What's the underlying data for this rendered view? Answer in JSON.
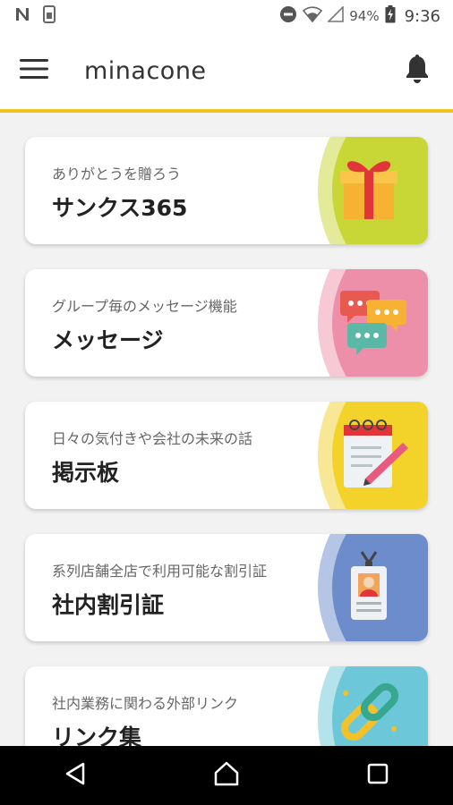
{
  "status_bar": {
    "battery_percent": "94%",
    "time": "9:36",
    "icons": [
      "n-icon",
      "sim-icon",
      "dnd-icon",
      "wifi-icon",
      "signal-icon",
      "battery-charging-icon"
    ]
  },
  "app_bar": {
    "title": "minacone",
    "menu_icon": "hamburger-menu-icon",
    "bell_icon": "bell-icon"
  },
  "cards": [
    {
      "subtitle": "ありがとうを贈ろう",
      "title": "サンクス365",
      "icon": "gift-icon",
      "color": "#c8d636",
      "ring_color": "#e3ea9a"
    },
    {
      "subtitle": "グループ毎のメッセージ機能",
      "title": "メッセージ",
      "icon": "chat-bubbles-icon",
      "color": "#ee8fa9",
      "ring_color": "#f7c9d5"
    },
    {
      "subtitle": "日々の気付きや会社の未来の話",
      "title": "掲示板",
      "icon": "notepad-pencil-icon",
      "color": "#f3d32a",
      "ring_color": "#f8e895"
    },
    {
      "subtitle": "系列店舗全店で利用可能な割引証",
      "title": "社内割引証",
      "icon": "id-badge-icon",
      "color": "#6c8ccc",
      "ring_color": "#b5c5e5"
    },
    {
      "subtitle": "社内業務に関わる外部リンク",
      "title": "リンク集",
      "icon": "chain-link-icon",
      "color": "#6cc8d8",
      "ring_color": "#b5e3eb"
    }
  ],
  "nav_bar": {
    "back_icon": "back-triangle-icon",
    "home_icon": "home-icon",
    "recents_icon": "recents-square-icon"
  }
}
